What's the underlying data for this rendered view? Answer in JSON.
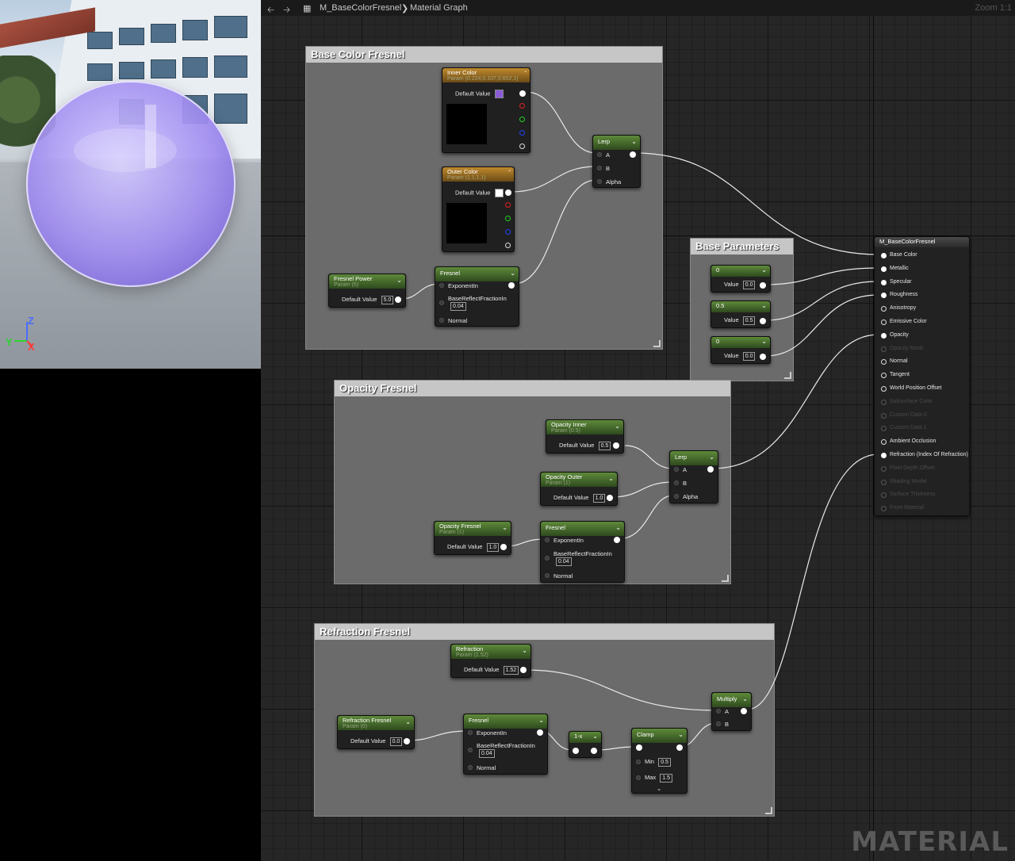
{
  "breadcrumb": {
    "asset": "M_BaseColorFresnel",
    "graph": "Material Graph"
  },
  "zoom_label": "Zoom 1:1",
  "watermark": "MATERIAL",
  "gizmo": {
    "z": "Z",
    "y": "Y",
    "x": "X"
  },
  "comments": {
    "base_color": "Base Color Fresnel",
    "base_params": "Base Parameters",
    "opacity": "Opacity Fresnel",
    "refraction": "Refraction Fresnel"
  },
  "nodes": {
    "inner_color": {
      "title": "Inner Color",
      "subtitle": "Param (0.224,0.107,0.602,1)",
      "label": "Default Value",
      "swatch": "#8a5cd6"
    },
    "outer_color": {
      "title": "Outer Color",
      "subtitle": "Param (1,1,1,1)",
      "label": "Default Value",
      "swatch": "#ffffff"
    },
    "lerp1": {
      "title": "Lerp",
      "a": "A",
      "b": "B",
      "alpha": "Alpha"
    },
    "fresnel_power": {
      "title": "Fresnel Power",
      "subtitle": "Param (5)",
      "label": "Default Value",
      "value": "5.0"
    },
    "fresnel1": {
      "title": "Fresnel",
      "exp": "ExponentIn",
      "brf": "BaseReflectFractionIn",
      "brf_val": "0.04",
      "normal": "Normal"
    },
    "const_metal": {
      "title": "0",
      "label": "Value",
      "value": "0.0"
    },
    "const_spec": {
      "title": "0.5",
      "label": "Value",
      "value": "0.5"
    },
    "const_rough": {
      "title": "0",
      "label": "Value",
      "value": "0.0"
    },
    "opacity_inner": {
      "title": "Opacity Inner",
      "subtitle": "Param (0.5)",
      "label": "Default Value",
      "value": "0.5"
    },
    "opacity_outer": {
      "title": "Opacity Outer",
      "subtitle": "Param (1)",
      "label": "Default Value",
      "value": "1.0"
    },
    "opacity_fresnel": {
      "title": "Opacity Fresnel",
      "subtitle": "Param (1)",
      "label": "Default Value",
      "value": "1.0"
    },
    "lerp2": {
      "title": "Lerp",
      "a": "A",
      "b": "B",
      "alpha": "Alpha"
    },
    "fresnel2": {
      "title": "Fresnel",
      "exp": "ExponentIn",
      "brf": "BaseReflectFractionIn",
      "brf_val": "0.04",
      "normal": "Normal"
    },
    "refraction": {
      "title": "Refraction",
      "subtitle": "Param (1.52)",
      "label": "Default Value",
      "value": "1.52"
    },
    "refraction_fresnel": {
      "title": "Refraction Fresnel",
      "subtitle": "Param (0)",
      "label": "Default Value",
      "value": "0.0"
    },
    "fresnel3": {
      "title": "Fresnel",
      "exp": "ExponentIn",
      "brf": "BaseReflectFractionIn",
      "brf_val": "0.04",
      "normal": "Normal"
    },
    "one_minus": {
      "title": "1-x"
    },
    "clamp": {
      "title": "Clamp",
      "min_label": "Min",
      "min": "0.5",
      "max_label": "Max",
      "max": "1.5"
    },
    "multiply": {
      "title": "Multiply",
      "a": "A",
      "b": "B"
    }
  },
  "result": {
    "title": "M_BaseColorFresnel",
    "pins": [
      {
        "label": "Base Color",
        "state": "connected"
      },
      {
        "label": "Metallic",
        "state": "connected"
      },
      {
        "label": "Specular",
        "state": "connected"
      },
      {
        "label": "Roughness",
        "state": "connected"
      },
      {
        "label": "Anisotropy",
        "state": "open"
      },
      {
        "label": "Emissive Color",
        "state": "open"
      },
      {
        "label": "Opacity",
        "state": "connected"
      },
      {
        "label": "Opacity Mask",
        "state": "disabled"
      },
      {
        "label": "Normal",
        "state": "open"
      },
      {
        "label": "Tangent",
        "state": "open"
      },
      {
        "label": "World Position Offset",
        "state": "open"
      },
      {
        "label": "Subsurface Color",
        "state": "disabled"
      },
      {
        "label": "Custom Data 0",
        "state": "disabled"
      },
      {
        "label": "Custom Data 1",
        "state": "disabled"
      },
      {
        "label": "Ambient Occlusion",
        "state": "open"
      },
      {
        "label": "Refraction (Index Of Refraction)",
        "state": "connected"
      },
      {
        "label": "Pixel Depth Offset",
        "state": "disabled"
      },
      {
        "label": "Shading Model",
        "state": "disabled"
      },
      {
        "label": "Surface Thickness",
        "state": "disabled"
      },
      {
        "label": "Front Material",
        "state": "disabled"
      }
    ]
  }
}
